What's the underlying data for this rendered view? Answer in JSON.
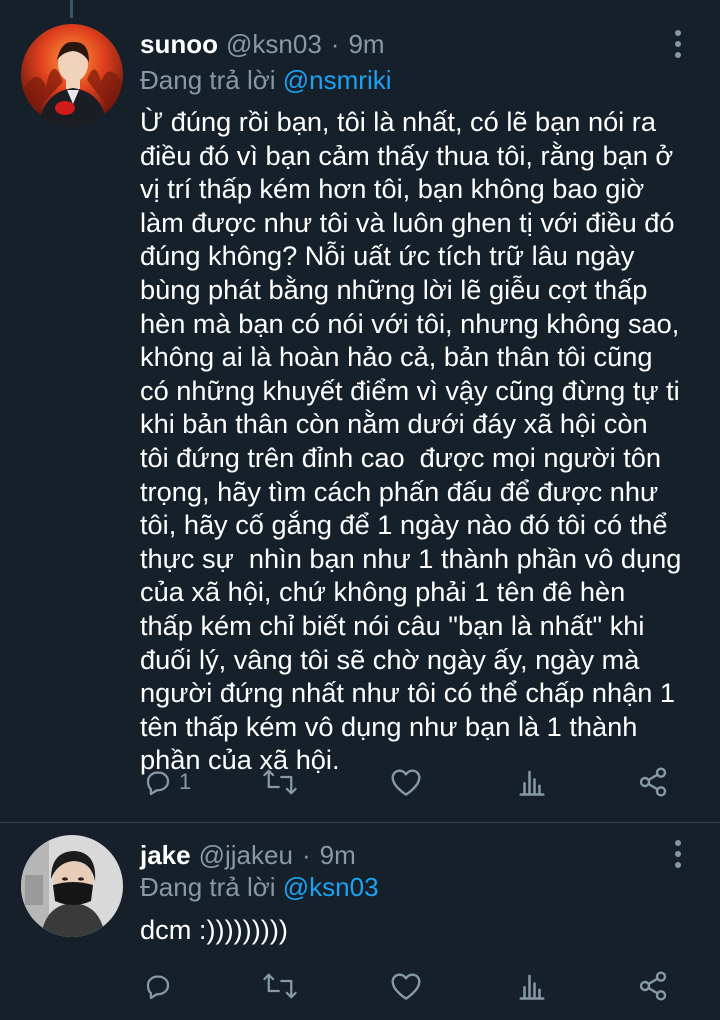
{
  "colors": {
    "background": "#15202b",
    "text_primary": "#ffffff",
    "text_secondary": "#8899a6",
    "link": "#1da1f2",
    "divider": "#38444d"
  },
  "tweets": [
    {
      "display_name": "sunoo",
      "handle": "@ksn03",
      "separator": "·",
      "time": "9m",
      "replying_prefix": "Đang trả lời ",
      "replying_to": "@nsmriki",
      "text": "Ừ đúng rồi bạn, tôi là nhất, có lẽ bạn nói ra\nđiều đó vì bạn cảm thấy thua tôi, rằng bạn ở\nvị trí thấp kém hơn tôi, bạn không bao giờ\nlàm được như tôi và luôn ghen tị với điều đó\nđúng không? Nỗi uất ức tích trữ lâu ngày\nbùng phát bằng những lời lẽ giễu cợt thấp\nhèn mà bạn có nói với tôi, nhưng không sao,\nkhông ai là hoàn hảo cả, bản thân tôi cũng\ncó những khuyết điểm vì vậy cũng đừng tự ti\nkhi bản thân còn nằm dưới đáy xã hội còn\ntôi đứng trên đỉnh cao  được mọi người tôn\ntrọng, hãy tìm cách phấn đấu để được như\ntôi, hãy cố gắng để 1 ngày nào đó tôi có thể\nthực sự  nhìn bạn như 1 thành phần vô dụng\ncủa xã hội, chứ không phải 1 tên đê hèn\nthấp kém chỉ biết nói câu \"bạn là nhất\" khi\nđuối lý, vâng tôi sẽ chờ ngày ấy, ngày mà\nngười đứng nhất như tôi có thể chấp nhận 1\ntên thấp kém vô dụng như bạn là 1 thành\nphần của xã hội.",
      "reply_count": "1",
      "icons": [
        "more-vertical-icon",
        "reply-icon",
        "retweet-icon",
        "like-icon",
        "analytics-icon",
        "share-icon"
      ]
    },
    {
      "display_name": "jake",
      "handle": "@jjakeu",
      "separator": "·",
      "time": "9m",
      "replying_prefix": "Đang trả lời ",
      "replying_to": "@ksn03",
      "text": "dcm :)))))))))",
      "reply_count": "",
      "icons": [
        "more-vertical-icon",
        "reply-icon",
        "retweet-icon",
        "like-icon",
        "analytics-icon",
        "share-icon"
      ]
    }
  ]
}
